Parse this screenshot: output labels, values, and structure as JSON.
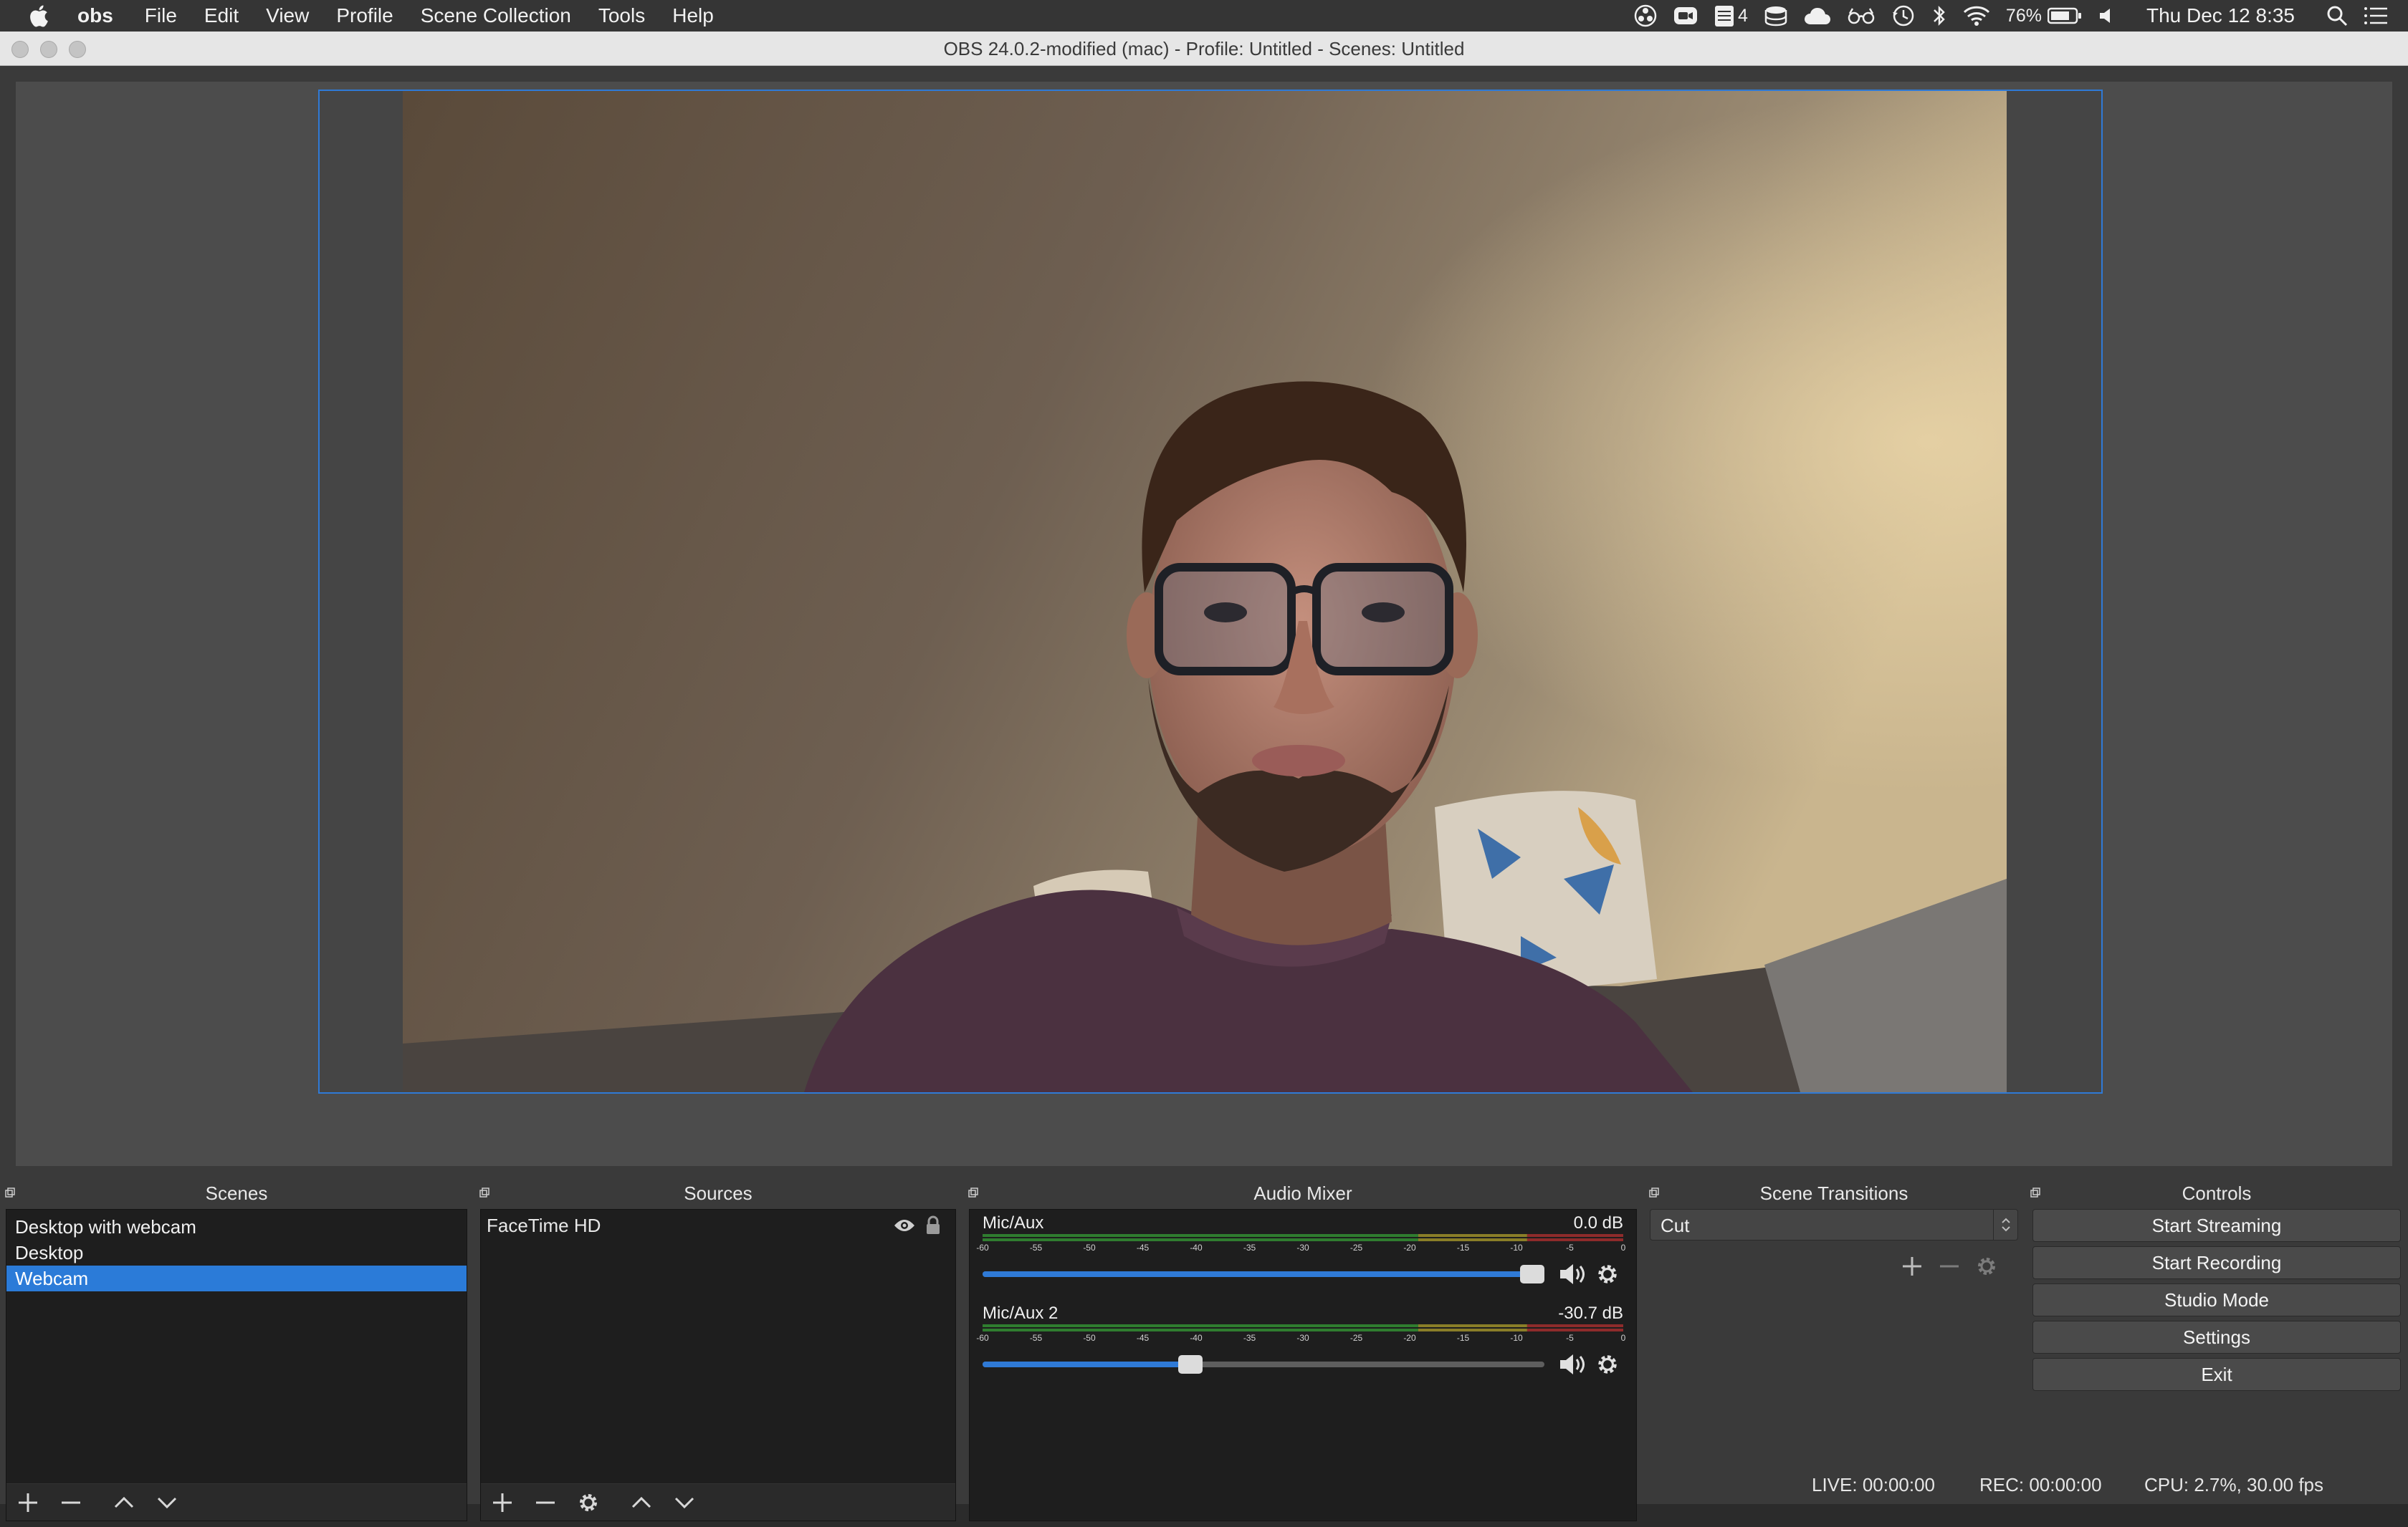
{
  "menubar": {
    "app_name": "obs",
    "items": [
      "File",
      "Edit",
      "View",
      "Profile",
      "Scene Collection",
      "Tools",
      "Help"
    ],
    "tray_badge": "4",
    "battery": "76%",
    "clock": "Thu Dec 12  8:35"
  },
  "window": {
    "title": "OBS 24.0.2-modified (mac) - Profile: Untitled - Scenes: Untitled"
  },
  "scenes": {
    "header": "Scenes",
    "items": [
      "Desktop with webcam",
      "Desktop",
      "Webcam"
    ],
    "selected_index": 2
  },
  "sources": {
    "header": "Sources",
    "items": [
      {
        "name": "FaceTime HD",
        "visible": true,
        "locked": true
      }
    ]
  },
  "audio_mixer": {
    "header": "Audio Mixer",
    "scale_labels": [
      "-60",
      "-55",
      "-50",
      "-45",
      "-40",
      "-35",
      "-30",
      "-25",
      "-20",
      "-15",
      "-10",
      "-5",
      "0"
    ],
    "channels": [
      {
        "name": "Mic/Aux",
        "level": "0.0 dB",
        "fader_fraction": 1.0
      },
      {
        "name": "Mic/Aux 2",
        "level": "-30.7 dB",
        "fader_fraction": 0.37
      }
    ]
  },
  "scene_transitions": {
    "header": "Scene Transitions",
    "selected": "Cut"
  },
  "controls": {
    "header": "Controls",
    "buttons": [
      "Start Streaming",
      "Start Recording",
      "Studio Mode",
      "Settings",
      "Exit"
    ]
  },
  "status": {
    "live": "LIVE: 00:00:00",
    "rec": "REC: 00:00:00",
    "cpu": "CPU: 2.7%, 30.00 fps"
  },
  "colors": {
    "accent": "#2b7bd8",
    "panel_bg": "#1e1e1e",
    "window_bg": "#3a3a3a",
    "meter_green": "#3aa33a",
    "meter_yellow": "#b5a532",
    "meter_red": "#c23a3a"
  }
}
